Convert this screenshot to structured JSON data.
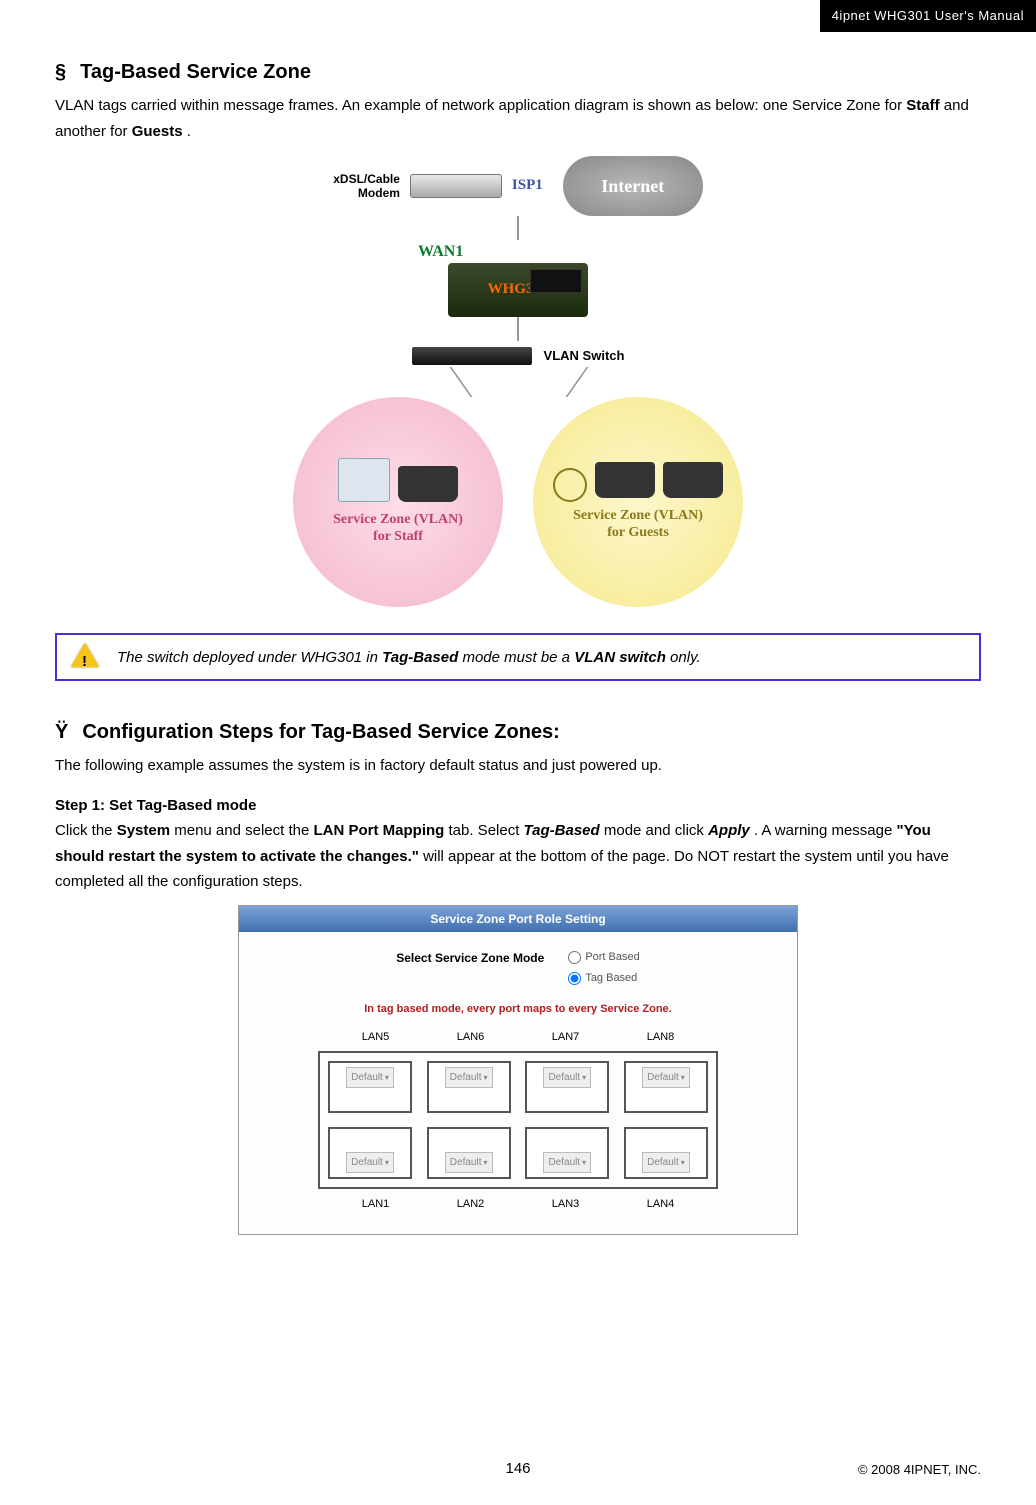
{
  "header": {
    "doc_title": "4ipnet WHG301 User's Manual"
  },
  "section1": {
    "bullet": "§",
    "title": "Tag-Based Service Zone",
    "intro_pre": "VLAN tags carried within message frames. An example of network application diagram is shown as below: one Service Zone for ",
    "intro_b1": "Staff",
    "intro_mid": " and another for ",
    "intro_b2": "Guests",
    "intro_end": "."
  },
  "diagram": {
    "modem_label_l1": "xDSL/Cable",
    "modem_label_l2": "Modem",
    "isp": "ISP1",
    "cloud": "Internet",
    "wan": "WAN1",
    "whg": "WHG301",
    "vlan_switch": "VLAN Switch",
    "zone_staff_l1": "Service Zone (VLAN)",
    "zone_staff_l2": "for Staff",
    "zone_guest_l1": "Service Zone (VLAN)",
    "zone_guest_l2": "for Guests"
  },
  "note": {
    "t1": "The switch deployed under WHG301 in ",
    "b1": "Tag-Based",
    "t2": " mode must be a ",
    "b2": "VLAN switch",
    "t3": " only."
  },
  "section2": {
    "bullet": "Ÿ",
    "title": "Configuration Steps for Tag-Based Service Zones:",
    "intro": "The following example assumes the system is in factory default status and just powered up."
  },
  "step1": {
    "label": "Step 1: Set Tag-Based mode",
    "t1": "Click the ",
    "b1": "System",
    "t2": " menu and select the ",
    "b2": "LAN Port Mapping",
    "t3": " tab. Select ",
    "bi1": "Tag-Based",
    "t4": " mode and click ",
    "bi2": "Apply",
    "t5": ". A warning message ",
    "q1": "\"You should restart the system to activate the changes.\"",
    "t6": " will appear at the bottom of the page. Do NOT restart the system until you have completed all the configuration steps."
  },
  "screenshot": {
    "panel_title": "Service Zone Port Role Setting",
    "mode_label": "Select Service Zone Mode",
    "radio1": "Port Based",
    "radio2": "Tag Based",
    "warn_text": "In tag based mode, every port maps to every Service Zone.",
    "top_labels": [
      "LAN5",
      "LAN6",
      "LAN7",
      "LAN8"
    ],
    "bottom_labels": [
      "LAN1",
      "LAN2",
      "LAN3",
      "LAN4"
    ],
    "port_value": "Default"
  },
  "footer": {
    "page": "146",
    "copyright": "© 2008 4IPNET, INC."
  }
}
